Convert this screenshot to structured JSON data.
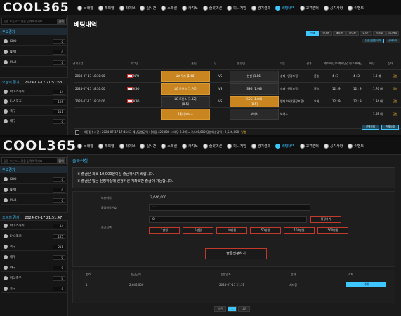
{
  "brand": {
    "logo": "COOL365"
  },
  "nav": [
    "국내형",
    "해외형",
    "라이브",
    "실시간",
    "스페셜",
    "카지노",
    "슬롯머신",
    "미니게임",
    "경기결과",
    "배팅내역",
    "고객센터",
    "공지사항",
    "이벤트"
  ],
  "nav_active_index": 9,
  "sidebar": {
    "search_placeholder": "팀명 또는 리그명을 입력해주세요",
    "search_button": "검색",
    "main_games_title": "주요경기",
    "main_games": [
      {
        "label": "KBO",
        "count": "0"
      },
      {
        "label": "NPB",
        "count": "0"
      },
      {
        "label": "MLB",
        "count": "0"
      }
    ],
    "today_label": "오늘의 경기",
    "today_time_1": "2024-07-17 21:51:53",
    "today_time_2": "2024-07-17 21:51:47",
    "sports_1": [
      {
        "label": "아이스하키",
        "count": "14"
      },
      {
        "label": "E-스포츠",
        "count": "125"
      },
      {
        "label": "축구",
        "count": "211"
      },
      {
        "label": "배구",
        "count": "0"
      }
    ],
    "sports_2": [
      {
        "label": "아이스하키",
        "count": "14"
      },
      {
        "label": "E-스포츠",
        "count": "125"
      },
      {
        "label": "축구",
        "count": "211"
      },
      {
        "label": "배구",
        "count": "0"
      },
      {
        "label": "야구",
        "count": "0"
      },
      {
        "label": "미식축구",
        "count": "0"
      },
      {
        "label": "농구",
        "count": "0"
      }
    ]
  },
  "bet_history": {
    "title": "베팅내역",
    "filters": [
      "전체",
      "국내형",
      "해외형",
      "라이브",
      "실시간",
      "스페셜",
      "미니게임"
    ],
    "tab_a": "당첨금반환내역",
    "tab_b": "선택삭제",
    "headers": [
      "경기시간",
      "리그명",
      "홈팀",
      "무",
      "원정팀",
      "타입",
      "결과",
      "취득배당/소계배당",
      "경기/소계배당",
      "배당",
      "상태"
    ],
    "rows": [
      {
        "time": "2024-07-17 18:30:00",
        "league": "NPB",
        "home": "요미우리 [1.68]",
        "draw": "VS",
        "away": "한신 [1.86]",
        "type": "승패 (연장포함)",
        "result": "홈승",
        "score1": "4 : 3",
        "score2": "4 : 3",
        "odds": "1.8 배",
        "status": "당첨"
      },
      {
        "time": "2024-07-17 18:30:00",
        "league": "KBO",
        "home": "LG 트윈스 [1.76]",
        "draw": "VS",
        "away": "SSG [1.96]",
        "type": "승패 (연장포함)",
        "result": "홈승",
        "score1": "12 : 9",
        "score2": "12 : 9",
        "odds": "1.76 배",
        "status": "당첨"
      },
      {
        "time": "2024-07-17 18:30:00",
        "league": "KBO",
        "home": "LG 트윈스 [1.82]",
        "draw": "VS",
        "away": "SSG [1.84]",
        "type": "언더오버 (연장포함)",
        "result": "오버",
        "score1": "12 : 9",
        "score2": "12 : 9",
        "odds": "1.84 배",
        "status": "당첨"
      },
      {
        "time": "-",
        "league": "",
        "home": "3폴더 보너스",
        "draw": "",
        "away": "보너스",
        "type": "보너스",
        "result": "-",
        "score1": "-",
        "score2": "-",
        "odds": "1.05 배",
        "status": "당첨"
      }
    ],
    "home_sub": "[8.5]",
    "away_sub": "[8.5]",
    "summary": "배팅접수시간 : 2024-07-17 17:45:53  예상당첨금액 : [배팅 420,000 × 배당 6.30] = 2,646,000  당첨예상금액 : 2,646,000",
    "summary_status": "당첨",
    "footer_btns": [
      "선택삭제",
      "전체삭제"
    ]
  },
  "withdraw": {
    "title": "출금신청",
    "notices": [
      "※ 출금은 최소 10,000원이상 출금하시기 바랍니다.",
      "※ 출금은 입금 신청하실때 신청하신 계좌로만 출금이 가능합니다."
    ],
    "balance_label": "보유머니",
    "balance_value": "2,646,000",
    "password_label": "출금비밀번호",
    "password_value": "••••",
    "amount_label": "출금금액",
    "amount_value": "0",
    "reset_btn": "정정하기",
    "quick_amounts": [
      "1만원",
      "5만원",
      "10만원",
      "50만원",
      "100만원",
      "500만원"
    ],
    "submit": "출금신청하기",
    "table_headers": [
      "번호",
      "출금금액",
      "신청일자",
      "상태",
      "삭제"
    ],
    "table_row": {
      "no": "1",
      "amount": "2,646,000",
      "date": "2024-07-17 21:51",
      "status": "처리중",
      "action": "삭제"
    },
    "pager": [
      "이전",
      "1",
      "다음"
    ]
  }
}
